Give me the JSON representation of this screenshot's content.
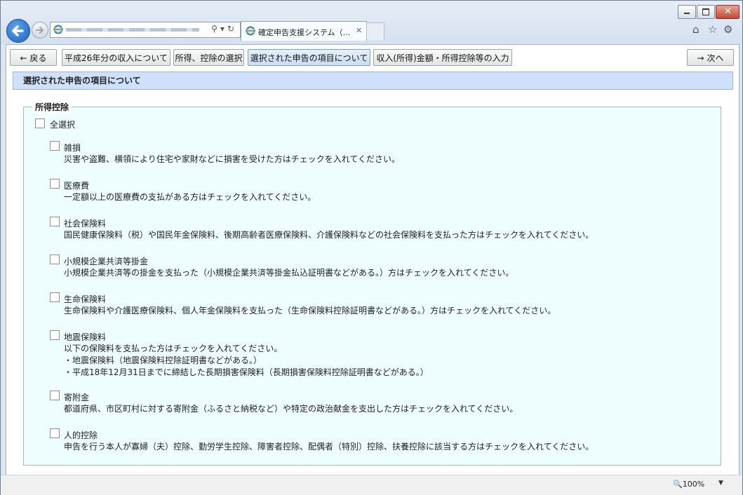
{
  "browser": {
    "tab_title": "確定申告支援システム（...",
    "zoom": "100%"
  },
  "nav": {
    "back": "戻る",
    "step1": "平成26年分の収入について",
    "step2": "所得、控除の選択",
    "step3": "選択された申告の項目について",
    "step4": "収入(所得)金額・所得控除等の入力",
    "next": "次へ"
  },
  "section_title": "選択された申告の項目について",
  "deductions": {
    "legend": "所得控除",
    "select_all": "全選択",
    "items": [
      {
        "label": "雑損",
        "desc": [
          "災害や盗難、横領により住宅や家財などに損害を受けた方はチェックを入れてください。"
        ]
      },
      {
        "label": "医療費",
        "desc": [
          "一定額以上の医療費の支払がある方はチェックを入れてください。"
        ]
      },
      {
        "label": "社会保険料",
        "desc": [
          "国民健康保険料（税）や国民年金保険料、後期高齢者医療保険料、介護保険料などの社会保険料を支払った方はチェックを入れてください。"
        ]
      },
      {
        "label": "小規模企業共済等掛金",
        "desc": [
          "小規模企業共済等の掛金を支払った（小規模企業共済等掛金払込証明書などがある。）方はチェックを入れてください。"
        ]
      },
      {
        "label": "生命保険料",
        "desc": [
          "生命保険料や介護医療保険料、個人年金保険料を支払った（生命保険料控除証明書などがある。）方はチェックを入れてください。"
        ]
      },
      {
        "label": "地震保険料",
        "desc": [
          "以下の保険料を支払った方はチェックを入れてください。",
          "・地震保険料（地震保険料控除証明書などがある。）",
          "・平成18年12月31日までに締結した長期損害保険料（長期損害保険料控除証明書などがある。）"
        ]
      },
      {
        "label": "寄附金",
        "desc": [
          "都道府県、市区町村に対する寄附金（ふるさと納税など）や特定の政治献金を支出した方はチェックを入れてください。"
        ]
      },
      {
        "label": "人的控除",
        "desc": [
          "申告を行う本人が寡婦（夫）控除、勤労学生控除、障害者控除、配偶者（特別）控除、扶養控除に該当する方はチェックを入れてください。"
        ]
      }
    ]
  }
}
